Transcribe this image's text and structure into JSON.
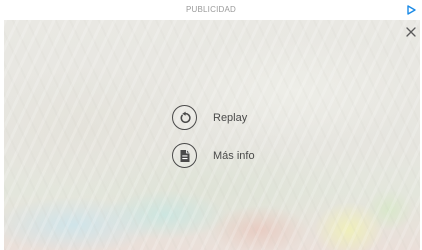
{
  "header": {
    "label": "PUBLICIDAD",
    "adchoices_icon": "adchoices-triangle-icon",
    "adchoices_color": "#1a8ae6"
  },
  "close": {
    "icon": "close-x-icon"
  },
  "actions": [
    {
      "label": "Replay",
      "icon": "replay-icon"
    },
    {
      "label": "Más info",
      "icon": "document-icon"
    }
  ],
  "colors": {
    "icon_text": "#4a4a4a",
    "header_text": "#9a9a9a"
  }
}
